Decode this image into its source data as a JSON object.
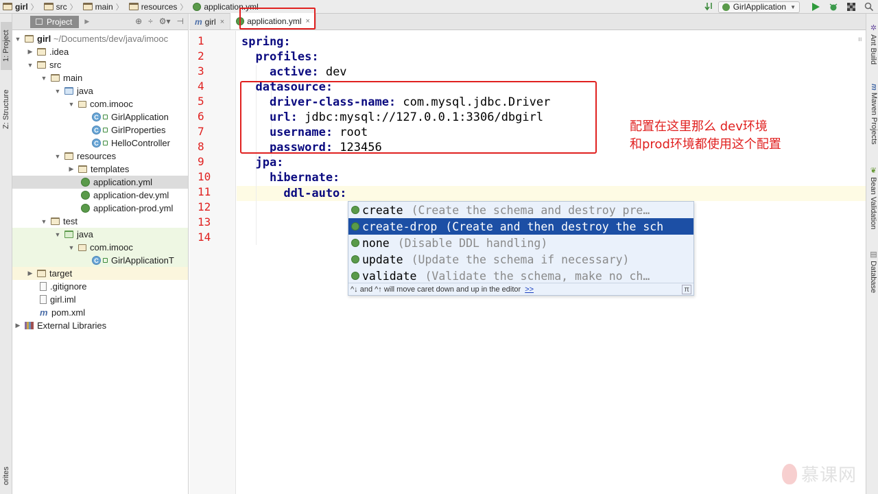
{
  "breadcrumb": [
    "girl",
    "src",
    "main",
    "resources",
    "application.yml"
  ],
  "run_config": "GirlApplication",
  "left_tabs": {
    "project": "1: Project",
    "structure": "Z: Structure",
    "favorites": "orites"
  },
  "right_tabs": [
    "Ant Build",
    "Maven Projects",
    "Bean Validation",
    "Database"
  ],
  "project_panel": {
    "tab_label": "Project",
    "tree": [
      {
        "label": "girl",
        "suffix": "~/Documents/dev/java/imooc"
      },
      {
        "label": ".idea"
      },
      {
        "label": "src"
      },
      {
        "label": "main"
      },
      {
        "label": "java"
      },
      {
        "label": "com.imooc"
      },
      {
        "label": "GirlApplication"
      },
      {
        "label": "GirlProperties"
      },
      {
        "label": "HelloController"
      },
      {
        "label": "resources"
      },
      {
        "label": "templates"
      },
      {
        "label": "application.yml"
      },
      {
        "label": "application-dev.yml"
      },
      {
        "label": "application-prod.yml"
      },
      {
        "label": "test"
      },
      {
        "label": "java"
      },
      {
        "label": "com.imooc"
      },
      {
        "label": "GirlApplicationT"
      },
      {
        "label": "target"
      },
      {
        "label": ".gitignore"
      },
      {
        "label": "girl.iml"
      },
      {
        "label": "pom.xml"
      },
      {
        "label": "External Libraries"
      }
    ]
  },
  "editor_tabs": [
    {
      "label": "girl",
      "close": "×"
    },
    {
      "label": "application.yml",
      "close": "×"
    }
  ],
  "line_numbers": [
    "1",
    "2",
    "3",
    "4",
    "5",
    "6",
    "7",
    "8",
    "9",
    "10",
    "11",
    "12",
    "13",
    "14"
  ],
  "code": {
    "l1": {
      "key": "spring:"
    },
    "l2": {
      "key": "  profiles:"
    },
    "l3": {
      "key": "    active:",
      "value": " dev"
    },
    "l4": {
      "key": "  datasource:"
    },
    "l5": {
      "key": "    driver-class-name:",
      "value": " com.mysql.jdbc.Driver"
    },
    "l6": {
      "key": "    url:",
      "value": " jdbc:mysql://127.0.0.1:3306/dbgirl"
    },
    "l7": {
      "key": "    username:",
      "value": " root"
    },
    "l8": {
      "key": "    password:",
      "value": " 123456"
    },
    "l9": {
      "key": "  jpa:"
    },
    "l10": {
      "key": "    hibernate:"
    },
    "l11": {
      "key": "      ddl-auto:"
    }
  },
  "annotation": {
    "line1": "配置在这里那么  dev环境",
    "line2": "和prod环境都使用这个配置"
  },
  "completion": {
    "items": [
      {
        "name": "create",
        "desc": "(Create the schema and destroy pre…"
      },
      {
        "name": "create-drop",
        "desc": "(Create and then destroy the sch"
      },
      {
        "name": "none",
        "desc": "(Disable DDL handling)"
      },
      {
        "name": "update",
        "desc": "(Update the schema if necessary)"
      },
      {
        "name": "validate",
        "desc": "(Validate the schema, make no ch…"
      }
    ],
    "footer": "^↓ and ^↑ will move caret down and up in the editor",
    "footer_link": ">>",
    "pi": "π"
  },
  "watermark": "慕课网",
  "colors": {
    "annotation_red": "#e0201f",
    "selection_blue": "#1c4fa5",
    "yaml_key": "#0b0b80"
  }
}
